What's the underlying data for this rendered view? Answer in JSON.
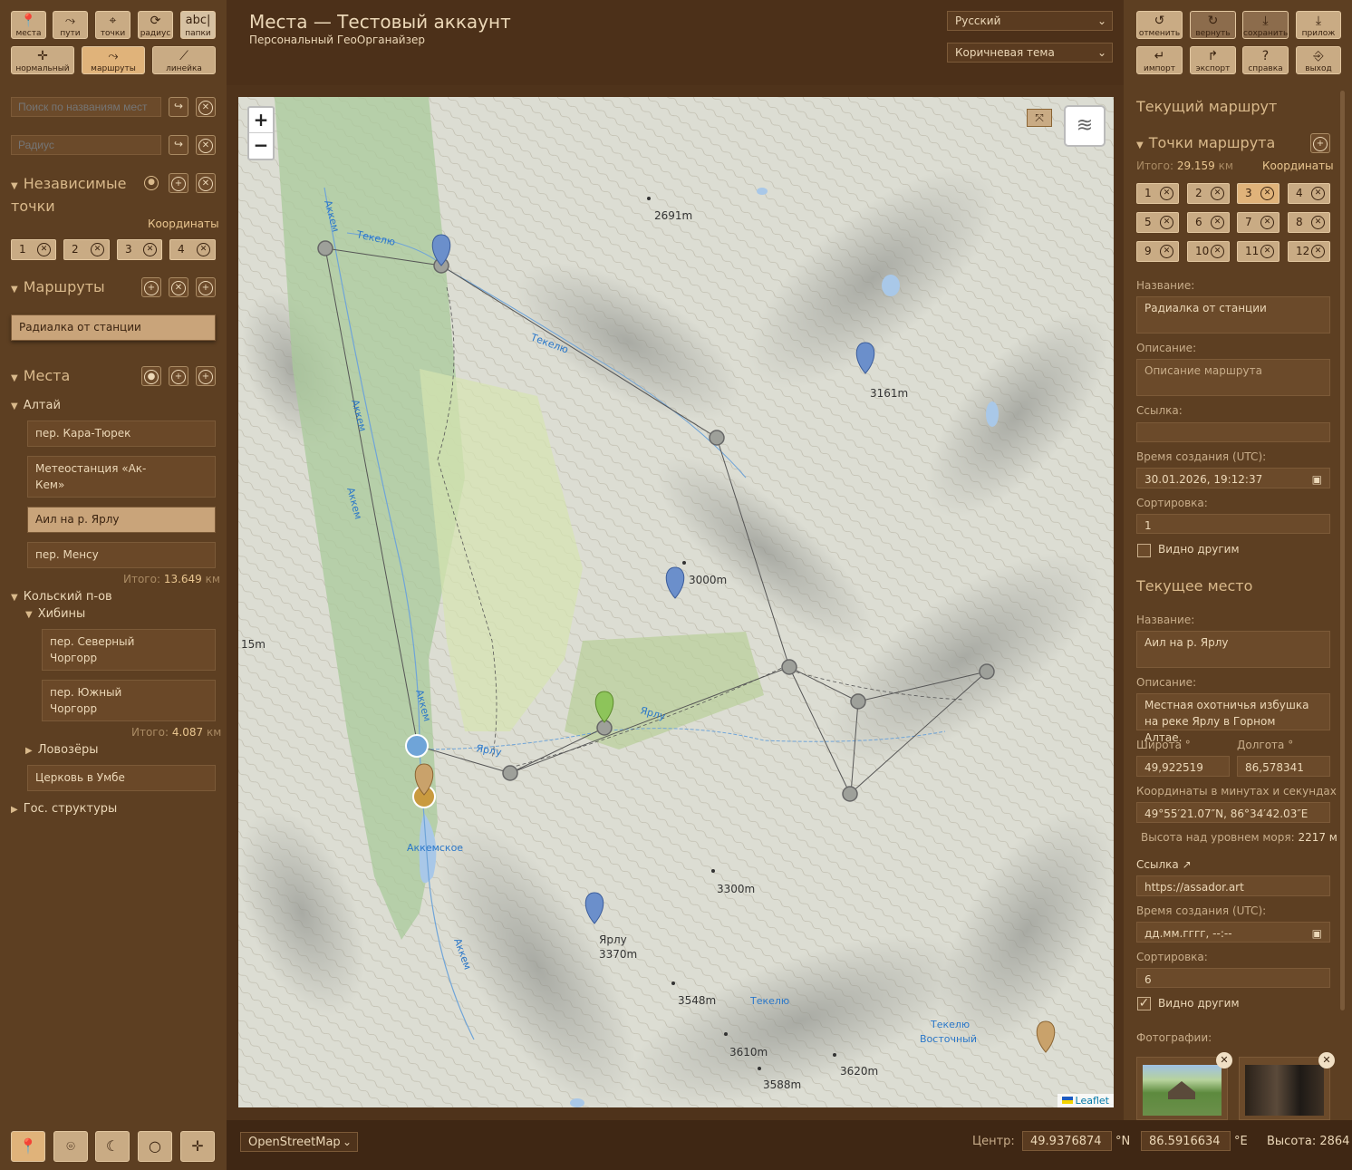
{
  "toolbar_left": {
    "row1": [
      {
        "label": "места",
        "icon": "pin-icon"
      },
      {
        "label": "пути",
        "icon": "path-icon"
      },
      {
        "label": "точки",
        "icon": "points-icon"
      },
      {
        "label": "радиус",
        "icon": "radius-icon"
      },
      {
        "label": "папки",
        "icon": "folders-icon",
        "glyph": "abc|"
      }
    ],
    "row2": [
      {
        "label": "нормальный",
        "icon": "crosshair-icon"
      },
      {
        "label": "маршруты",
        "icon": "routes-icon"
      },
      {
        "label": "линейка",
        "icon": "ruler-icon"
      }
    ]
  },
  "header": {
    "title": "Места — Тестовый аккаунт",
    "subtitle": "Персональный ГеоОрганайзер",
    "language": "Русский",
    "theme": "Коричневая тема"
  },
  "toolbar_right": {
    "row1": [
      "отменить",
      "вернуть",
      "сохранить",
      "прилож"
    ],
    "row2": [
      "импорт",
      "экспорт",
      "справка",
      "выход"
    ]
  },
  "left": {
    "search_placeholder": "Поиск по названиям мест",
    "radius_placeholder": "Радиус",
    "independent_title": "Независимые точки",
    "coords_label": "Координаты",
    "independent_points": [
      "1",
      "2",
      "3",
      "4"
    ],
    "routes_title": "Маршруты",
    "selected_route": "Радиалка от станции",
    "places_title": "Места",
    "group_altai": "Алтай",
    "altai_items": [
      "пер. Кара-Тюрек",
      "Метеостанция «Ак-Кем»",
      "Аил на р. Ярлу",
      "пер. Менсу"
    ],
    "altai_total_label": "Итого:",
    "altai_total": "13.649",
    "km": "км",
    "group_kola": "Кольский п-ов",
    "group_khibiny": "Хибины",
    "khibiny_items": [
      "пер. Северный Чоргорр",
      "пер. Южный Чоргорр"
    ],
    "khibiny_total": "4.087",
    "group_lovozery": "Ловозёры",
    "umba_item": "Церковь в Умбе",
    "group_gos": "Гос. структуры"
  },
  "right": {
    "current_route_title": "Текущий маршрут",
    "route_points_title": "Точки маршрута",
    "total_label": "Итого:",
    "total": "29.159",
    "km": "км",
    "coords_label": "Координаты",
    "route_points": [
      "1",
      "2",
      "3",
      "4",
      "5",
      "6",
      "7",
      "8",
      "9",
      "10",
      "11",
      "12"
    ],
    "name_label": "Название:",
    "route_name": "Радиалка от станции",
    "desc_label": "Описание:",
    "route_desc_placeholder": "Описание маршрута",
    "link_label": "Ссылка:",
    "created_label": "Время создания (UTC):",
    "route_created": "30.01.2026, 19:12:37",
    "sort_label": "Сортировка:",
    "route_sort": "1",
    "visible_label": "Видно другим",
    "current_place_title": "Текущее место",
    "place_name": "Аил на р. Ярлу",
    "place_desc": "Местная охотничья избушка на реке Ярлу в Горном Алтае.",
    "lat_label": "Широта °",
    "lon_label": "Долгота °",
    "lat": "49,922519",
    "lon": "86,578341",
    "dms_label": "Координаты в минутах и секундах",
    "dms": "49°55′21.07″N, 86°34′42.03″E",
    "alt_label": "Высота над уровнем моря:",
    "alt": "2217 м",
    "link2_label": "Ссылка",
    "place_link": "https://assador.art",
    "place_created_placeholder": "дд.мм.гггг, --:--",
    "place_sort": "6",
    "photos_label": "Фотографии:"
  },
  "map": {
    "labels": {
      "p2691": "2691m",
      "p3161": "3161m",
      "p3000": "3000m",
      "p15": "15m",
      "p3300": "3300m",
      "yarlu_peak": "Ярлу",
      "p3370": "3370m",
      "p3548": "3548m",
      "p3610": "3610m",
      "p3588": "3588m",
      "p3620": "3620m"
    },
    "water": {
      "akkem1": "Аккем",
      "tekelyu1": "Текелю",
      "tekelyu2": "Текелю",
      "akkem2": "Аккем",
      "akkem3": "Аккем",
      "akkem4": "Аккем",
      "yarlu1": "Ярлу",
      "yarlu2": "Ярлу",
      "lake": "Аккемское",
      "akkem5": "Аккем",
      "tekelyu3": "Текелю",
      "tekelyu_v1": "Текелю",
      "tekelyu_v2": "Восточный"
    },
    "attribution": "Leaflet",
    "zoom_in": "+",
    "zoom_out": "−"
  },
  "bottom": {
    "basemap": "OpenStreetMap",
    "center_label": "Центр:",
    "center_lat": "49.9376874",
    "n": "°N",
    "center_lon": "86.5916634",
    "e": "°E",
    "height_label": "Высота:",
    "height": "2864"
  },
  "colors": {
    "accent": "#e0b37a",
    "panel": "#5d3f22",
    "header": "#4c3019"
  }
}
